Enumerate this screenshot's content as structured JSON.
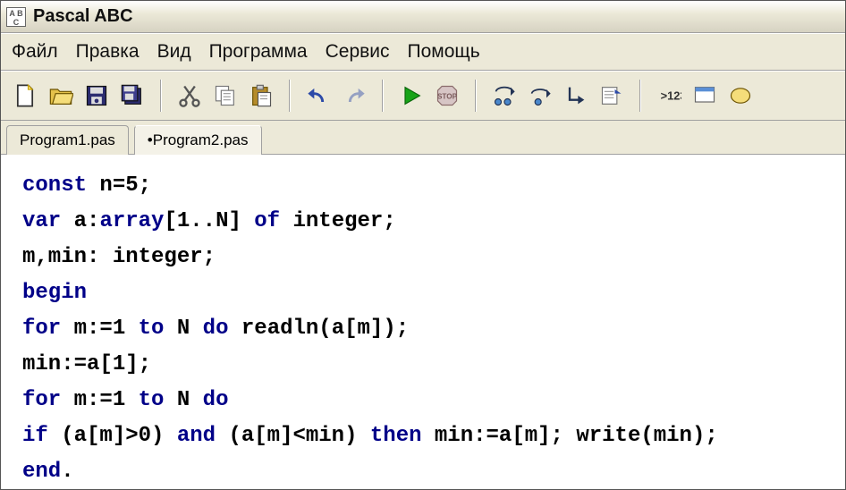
{
  "window": {
    "title": "Pascal ABC"
  },
  "menu": [
    "Файл",
    "Правка",
    "Вид",
    "Программа",
    "Сервис",
    "Помощь"
  ],
  "tabs": [
    {
      "label": "Program1.pas",
      "active": false
    },
    {
      "label": "•Program2.pas",
      "active": true
    }
  ],
  "code": [
    [
      {
        "t": "kw",
        "s": "const"
      },
      {
        "t": "plain",
        "s": " n=5;"
      }
    ],
    [
      {
        "t": "kw",
        "s": "var"
      },
      {
        "t": "plain",
        "s": " a:"
      },
      {
        "t": "kw",
        "s": "array"
      },
      {
        "t": "plain",
        "s": "[1..N] "
      },
      {
        "t": "kw",
        "s": "of"
      },
      {
        "t": "plain",
        "s": " integer;"
      }
    ],
    [
      {
        "t": "plain",
        "s": "m,min: integer;"
      }
    ],
    [
      {
        "t": "kw",
        "s": "begin"
      }
    ],
    [
      {
        "t": "kw",
        "s": "for"
      },
      {
        "t": "plain",
        "s": " m:=1 "
      },
      {
        "t": "kw",
        "s": "to"
      },
      {
        "t": "plain",
        "s": " N "
      },
      {
        "t": "kw",
        "s": "do"
      },
      {
        "t": "plain",
        "s": " readln(a[m]);"
      }
    ],
    [
      {
        "t": "plain",
        "s": "min:=a[1];"
      }
    ],
    [
      {
        "t": "kw",
        "s": "for"
      },
      {
        "t": "plain",
        "s": " m:=1 "
      },
      {
        "t": "kw",
        "s": "to"
      },
      {
        "t": "plain",
        "s": " N "
      },
      {
        "t": "kw",
        "s": "do"
      }
    ],
    [
      {
        "t": "kw",
        "s": "if"
      },
      {
        "t": "plain",
        "s": " (a[m]>0) "
      },
      {
        "t": "kw",
        "s": "and"
      },
      {
        "t": "plain",
        "s": " (a[m]<min) "
      },
      {
        "t": "kw",
        "s": "then"
      },
      {
        "t": "plain",
        "s": " min:=a[m]; write(min);"
      }
    ],
    [
      {
        "t": "kw",
        "s": "end"
      },
      {
        "t": "plain",
        "s": "."
      }
    ]
  ]
}
